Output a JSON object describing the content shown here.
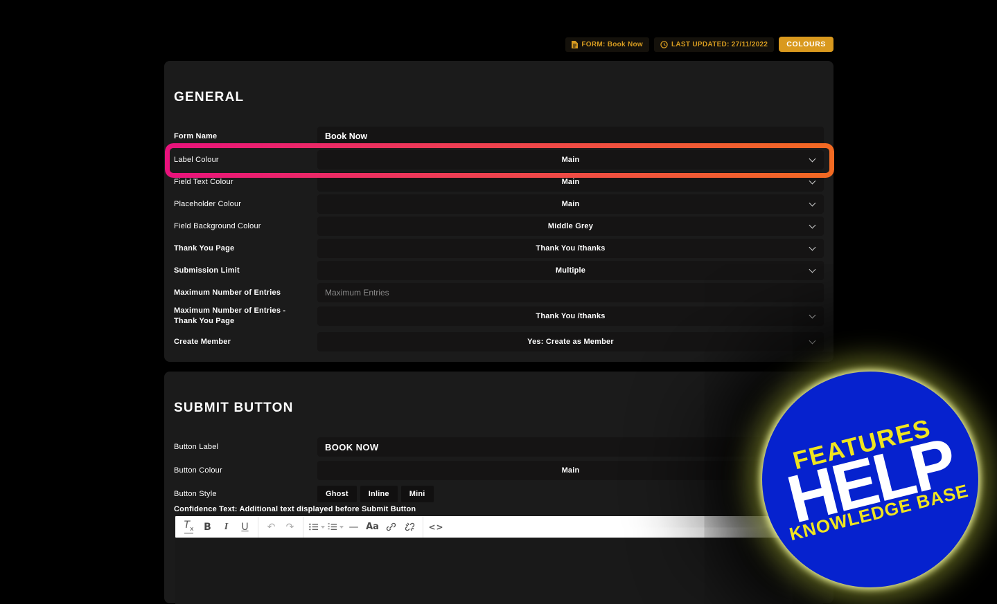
{
  "header": {
    "form_badge": "FORM: Book Now",
    "last_updated_badge": "LAST UPDATED: 27/11/2022",
    "colours_button": "COLOURS"
  },
  "general": {
    "title": "GENERAL",
    "rows": [
      {
        "label": "Form Name",
        "type": "input",
        "value": "Book Now"
      },
      {
        "label": "Label Colour",
        "type": "select",
        "value": "Main",
        "highlighted": true
      },
      {
        "label": "Field Text Colour",
        "type": "select",
        "value": "Main"
      },
      {
        "label": "Placeholder Colour",
        "type": "select",
        "value": "Main"
      },
      {
        "label": "Field Background Colour",
        "type": "select",
        "value": "Middle Grey"
      },
      {
        "label": "Thank You Page",
        "type": "select",
        "value": "Thank You /thanks"
      },
      {
        "label": "Submission Limit",
        "type": "select",
        "value": "Multiple"
      },
      {
        "label": "Maximum Number of Entries",
        "type": "input",
        "value": "",
        "placeholder": "Maximum Entries"
      },
      {
        "label": "Maximum Number of Entries - Thank You Page",
        "type": "select",
        "value": "Thank You /thanks"
      },
      {
        "label": "Create Member",
        "type": "select",
        "value": "Yes: Create as Member"
      }
    ]
  },
  "submit": {
    "title": "SUBMIT BUTTON",
    "button_label": {
      "label": "Button Label",
      "value": "BOOK NOW"
    },
    "button_colour": {
      "label": "Button Colour",
      "value": "Main"
    },
    "button_style": {
      "label": "Button Style",
      "options": [
        "Ghost",
        "Inline",
        "Mini"
      ]
    },
    "confidence_label": "Confidence Text: Additional text displayed before Submit Button",
    "toolbar": {
      "icons": [
        "clear-formatting",
        "bold",
        "italic",
        "underline",
        "undo",
        "redo",
        "unordered-list",
        "ordered-list",
        "horizontal-rule",
        "font-size",
        "link",
        "unlink",
        "source-code"
      ],
      "glyphs": {
        "clear_t": "T",
        "clear_x": "x",
        "bold": "B",
        "italic": "I",
        "underline": "U",
        "undo": "↶",
        "redo": "↷",
        "hr": "—",
        "font_size": "Aa",
        "code": "<>"
      }
    }
  },
  "help_badge": {
    "line1": "FEATURES",
    "line2": "HELP",
    "line3": "KNOWLEDGE BASE"
  },
  "colors": {
    "accent_gold": "#d9991e",
    "highlight_pink": "#e8127c",
    "highlight_orange": "#f26a22",
    "badge_blue": "#0622ce",
    "badge_yellow": "#f0e51f",
    "panel_bg": "#1b1b1b",
    "field_bg": "#151414"
  }
}
